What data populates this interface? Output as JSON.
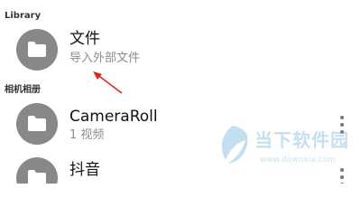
{
  "library": {
    "header": "Library",
    "item": {
      "title": "文件",
      "subtitle": "导入外部文件",
      "icon": "folder-icon"
    }
  },
  "albums": {
    "header": "相机相册",
    "items": [
      {
        "title": "CameraRoll",
        "subtitle": "1 视频",
        "icon": "folder-icon"
      },
      {
        "title": "抖音",
        "subtitle": "",
        "icon": "folder-icon"
      }
    ]
  },
  "annotation": {
    "color": "#d9261c"
  },
  "watermark": {
    "title": "当下软件园",
    "url": "www.downxia.com"
  },
  "colors": {
    "folder_circle": "#888888",
    "title_text": "#111111",
    "subtitle_text": "#8c8c8c"
  }
}
